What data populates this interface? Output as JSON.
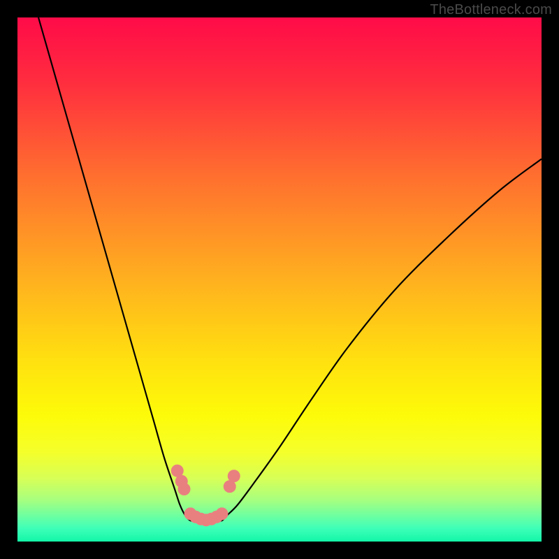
{
  "watermark": "TheBottleneck.com",
  "chart_data": {
    "type": "line",
    "title": "",
    "xlabel": "",
    "ylabel": "",
    "xlim": [
      0,
      100
    ],
    "ylim": [
      0,
      100
    ],
    "background_gradient": {
      "stops": [
        {
          "pos": 0.0,
          "color": "#ff0b48"
        },
        {
          "pos": 0.12,
          "color": "#ff2c3f"
        },
        {
          "pos": 0.3,
          "color": "#ff6e2f"
        },
        {
          "pos": 0.5,
          "color": "#ffb01f"
        },
        {
          "pos": 0.66,
          "color": "#ffe20f"
        },
        {
          "pos": 0.76,
          "color": "#fdfb09"
        },
        {
          "pos": 0.83,
          "color": "#f4ff2b"
        },
        {
          "pos": 0.88,
          "color": "#d7ff57"
        },
        {
          "pos": 0.92,
          "color": "#a8ff7e"
        },
        {
          "pos": 0.95,
          "color": "#6fffa0"
        },
        {
          "pos": 0.975,
          "color": "#3effb8"
        },
        {
          "pos": 1.0,
          "color": "#12f7a8"
        }
      ]
    },
    "series": [
      {
        "name": "left-curve",
        "x": [
          4,
          8,
          12,
          16,
          20,
          24,
          26,
          28,
          30,
          31,
          32,
          33,
          34
        ],
        "y": [
          100,
          86,
          72,
          58,
          44,
          30,
          23,
          16,
          10,
          7,
          5,
          4,
          4
        ]
      },
      {
        "name": "right-curve",
        "x": [
          38,
          39,
          40,
          42,
          45,
          50,
          56,
          63,
          72,
          82,
          92,
          100
        ],
        "y": [
          4,
          4,
          5,
          7,
          11,
          18,
          27,
          37,
          48,
          58,
          67,
          73
        ]
      }
    ],
    "markers": {
      "name": "highlight-dots",
      "color": "#e98080",
      "points": [
        {
          "x": 30.5,
          "y": 13.5
        },
        {
          "x": 31.3,
          "y": 11.5
        },
        {
          "x": 31.8,
          "y": 10.0
        },
        {
          "x": 33.0,
          "y": 5.3
        },
        {
          "x": 34.0,
          "y": 4.7
        },
        {
          "x": 35.0,
          "y": 4.3
        },
        {
          "x": 36.0,
          "y": 4.1
        },
        {
          "x": 37.0,
          "y": 4.3
        },
        {
          "x": 38.0,
          "y": 4.7
        },
        {
          "x": 39.0,
          "y": 5.3
        },
        {
          "x": 40.5,
          "y": 10.5
        },
        {
          "x": 41.3,
          "y": 12.5
        }
      ]
    }
  }
}
